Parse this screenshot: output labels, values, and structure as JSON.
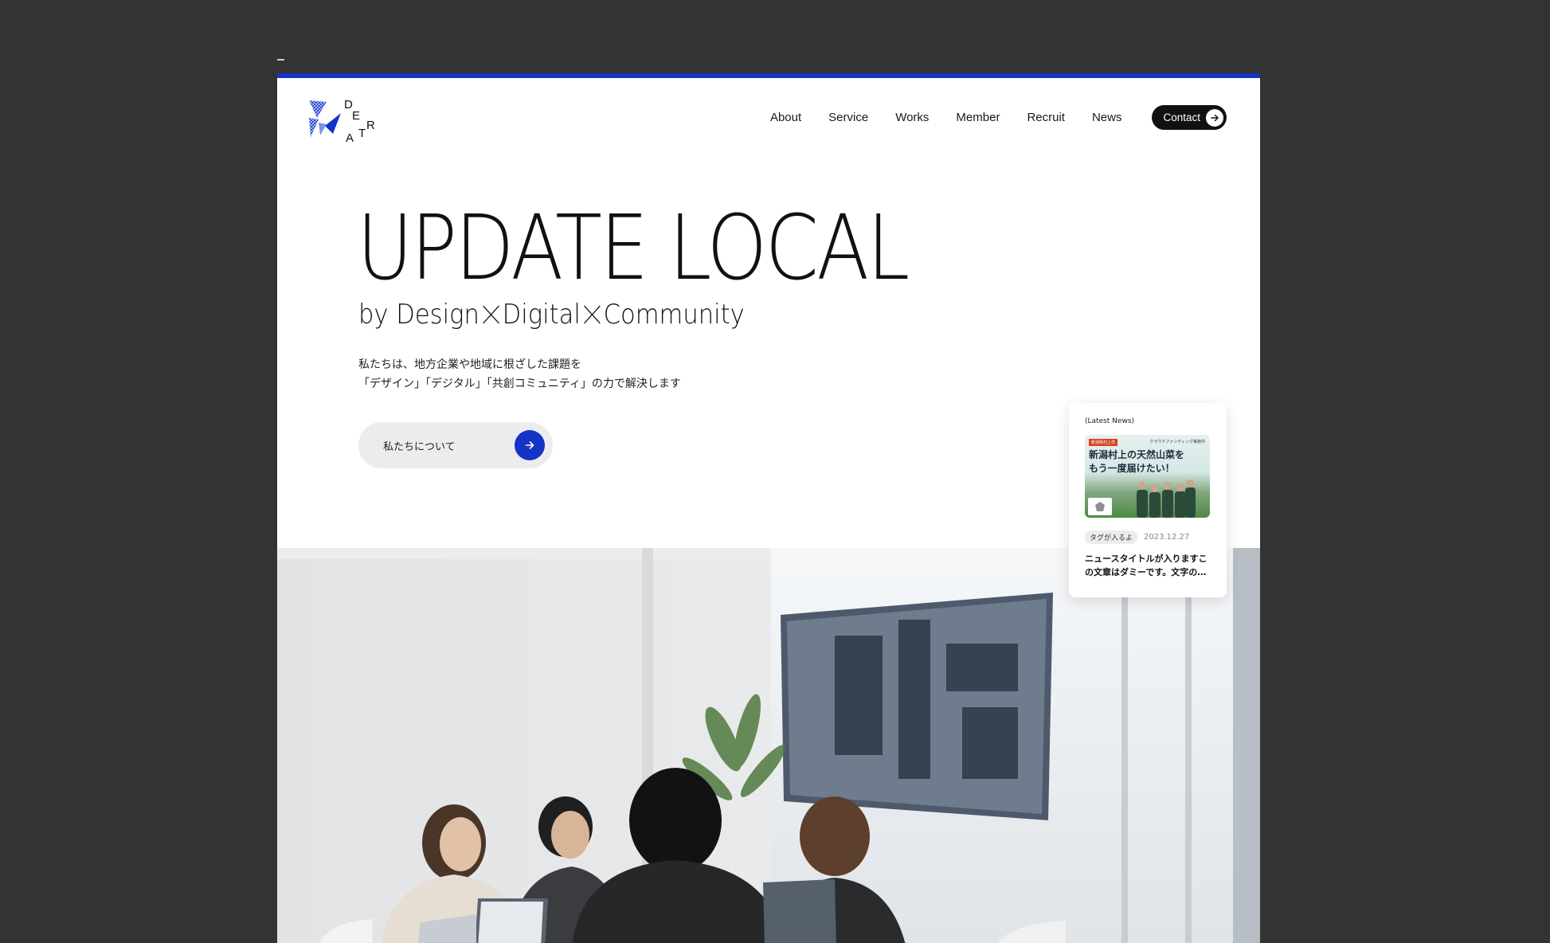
{
  "nav": {
    "items": [
      "About",
      "Service",
      "Works",
      "Member",
      "Recruit",
      "News"
    ],
    "contact_label": "Contact"
  },
  "logo": {
    "letters": [
      "D",
      "E",
      "R",
      "A",
      "T"
    ]
  },
  "hero": {
    "title": "UPDATE LOCAL",
    "subtitle_parts": [
      "by Design",
      "Digital",
      "Community"
    ],
    "description_line1": "私たちは、地方企業や地域に根ざした課題を",
    "description_line2": "「デザイン」「デジタル」「共創コミュニティ」の力で解決します",
    "about_button": "私たちについて"
  },
  "news_card": {
    "heading": "(Latest News)",
    "thumb_badge": "新潟県村上市",
    "thumb_small": "クラウドファンディング実施中",
    "thumb_title_line1": "新潟村上の天然山菜を",
    "thumb_title_line2": "もう一度届けたい！",
    "tag": "タグが入るよ",
    "date": "2023.12.27",
    "title": "ニュースタイトルが入りますこの文章はダミーです。文字の…"
  },
  "colors": {
    "accent": "#1334c6",
    "background": "#333333"
  }
}
